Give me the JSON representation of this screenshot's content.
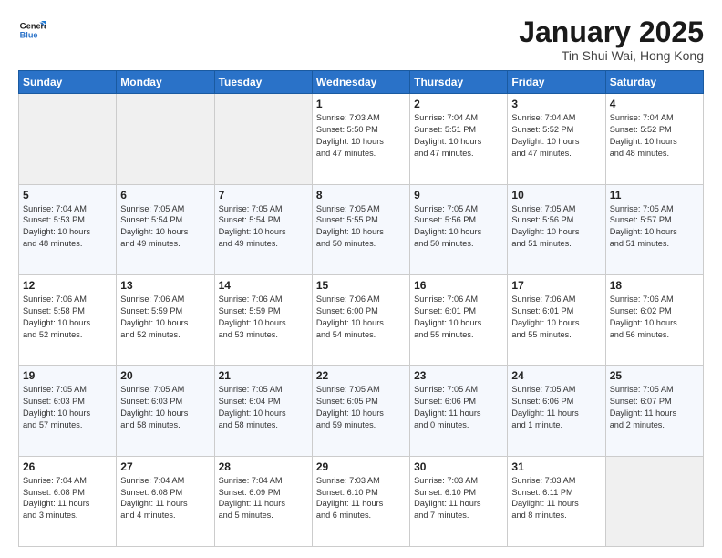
{
  "header": {
    "logo_line1": "General",
    "logo_line2": "Blue",
    "month": "January 2025",
    "location": "Tin Shui Wai, Hong Kong"
  },
  "weekdays": [
    "Sunday",
    "Monday",
    "Tuesday",
    "Wednesday",
    "Thursday",
    "Friday",
    "Saturday"
  ],
  "weeks": [
    [
      {
        "day": "",
        "info": ""
      },
      {
        "day": "",
        "info": ""
      },
      {
        "day": "",
        "info": ""
      },
      {
        "day": "1",
        "info": "Sunrise: 7:03 AM\nSunset: 5:50 PM\nDaylight: 10 hours\nand 47 minutes."
      },
      {
        "day": "2",
        "info": "Sunrise: 7:04 AM\nSunset: 5:51 PM\nDaylight: 10 hours\nand 47 minutes."
      },
      {
        "day": "3",
        "info": "Sunrise: 7:04 AM\nSunset: 5:52 PM\nDaylight: 10 hours\nand 47 minutes."
      },
      {
        "day": "4",
        "info": "Sunrise: 7:04 AM\nSunset: 5:52 PM\nDaylight: 10 hours\nand 48 minutes."
      }
    ],
    [
      {
        "day": "5",
        "info": "Sunrise: 7:04 AM\nSunset: 5:53 PM\nDaylight: 10 hours\nand 48 minutes."
      },
      {
        "day": "6",
        "info": "Sunrise: 7:05 AM\nSunset: 5:54 PM\nDaylight: 10 hours\nand 49 minutes."
      },
      {
        "day": "7",
        "info": "Sunrise: 7:05 AM\nSunset: 5:54 PM\nDaylight: 10 hours\nand 49 minutes."
      },
      {
        "day": "8",
        "info": "Sunrise: 7:05 AM\nSunset: 5:55 PM\nDaylight: 10 hours\nand 50 minutes."
      },
      {
        "day": "9",
        "info": "Sunrise: 7:05 AM\nSunset: 5:56 PM\nDaylight: 10 hours\nand 50 minutes."
      },
      {
        "day": "10",
        "info": "Sunrise: 7:05 AM\nSunset: 5:56 PM\nDaylight: 10 hours\nand 51 minutes."
      },
      {
        "day": "11",
        "info": "Sunrise: 7:05 AM\nSunset: 5:57 PM\nDaylight: 10 hours\nand 51 minutes."
      }
    ],
    [
      {
        "day": "12",
        "info": "Sunrise: 7:06 AM\nSunset: 5:58 PM\nDaylight: 10 hours\nand 52 minutes."
      },
      {
        "day": "13",
        "info": "Sunrise: 7:06 AM\nSunset: 5:59 PM\nDaylight: 10 hours\nand 52 minutes."
      },
      {
        "day": "14",
        "info": "Sunrise: 7:06 AM\nSunset: 5:59 PM\nDaylight: 10 hours\nand 53 minutes."
      },
      {
        "day": "15",
        "info": "Sunrise: 7:06 AM\nSunset: 6:00 PM\nDaylight: 10 hours\nand 54 minutes."
      },
      {
        "day": "16",
        "info": "Sunrise: 7:06 AM\nSunset: 6:01 PM\nDaylight: 10 hours\nand 55 minutes."
      },
      {
        "day": "17",
        "info": "Sunrise: 7:06 AM\nSunset: 6:01 PM\nDaylight: 10 hours\nand 55 minutes."
      },
      {
        "day": "18",
        "info": "Sunrise: 7:06 AM\nSunset: 6:02 PM\nDaylight: 10 hours\nand 56 minutes."
      }
    ],
    [
      {
        "day": "19",
        "info": "Sunrise: 7:05 AM\nSunset: 6:03 PM\nDaylight: 10 hours\nand 57 minutes."
      },
      {
        "day": "20",
        "info": "Sunrise: 7:05 AM\nSunset: 6:03 PM\nDaylight: 10 hours\nand 58 minutes."
      },
      {
        "day": "21",
        "info": "Sunrise: 7:05 AM\nSunset: 6:04 PM\nDaylight: 10 hours\nand 58 minutes."
      },
      {
        "day": "22",
        "info": "Sunrise: 7:05 AM\nSunset: 6:05 PM\nDaylight: 10 hours\nand 59 minutes."
      },
      {
        "day": "23",
        "info": "Sunrise: 7:05 AM\nSunset: 6:06 PM\nDaylight: 11 hours\nand 0 minutes."
      },
      {
        "day": "24",
        "info": "Sunrise: 7:05 AM\nSunset: 6:06 PM\nDaylight: 11 hours\nand 1 minute."
      },
      {
        "day": "25",
        "info": "Sunrise: 7:05 AM\nSunset: 6:07 PM\nDaylight: 11 hours\nand 2 minutes."
      }
    ],
    [
      {
        "day": "26",
        "info": "Sunrise: 7:04 AM\nSunset: 6:08 PM\nDaylight: 11 hours\nand 3 minutes."
      },
      {
        "day": "27",
        "info": "Sunrise: 7:04 AM\nSunset: 6:08 PM\nDaylight: 11 hours\nand 4 minutes."
      },
      {
        "day": "28",
        "info": "Sunrise: 7:04 AM\nSunset: 6:09 PM\nDaylight: 11 hours\nand 5 minutes."
      },
      {
        "day": "29",
        "info": "Sunrise: 7:03 AM\nSunset: 6:10 PM\nDaylight: 11 hours\nand 6 minutes."
      },
      {
        "day": "30",
        "info": "Sunrise: 7:03 AM\nSunset: 6:10 PM\nDaylight: 11 hours\nand 7 minutes."
      },
      {
        "day": "31",
        "info": "Sunrise: 7:03 AM\nSunset: 6:11 PM\nDaylight: 11 hours\nand 8 minutes."
      },
      {
        "day": "",
        "info": ""
      }
    ]
  ]
}
